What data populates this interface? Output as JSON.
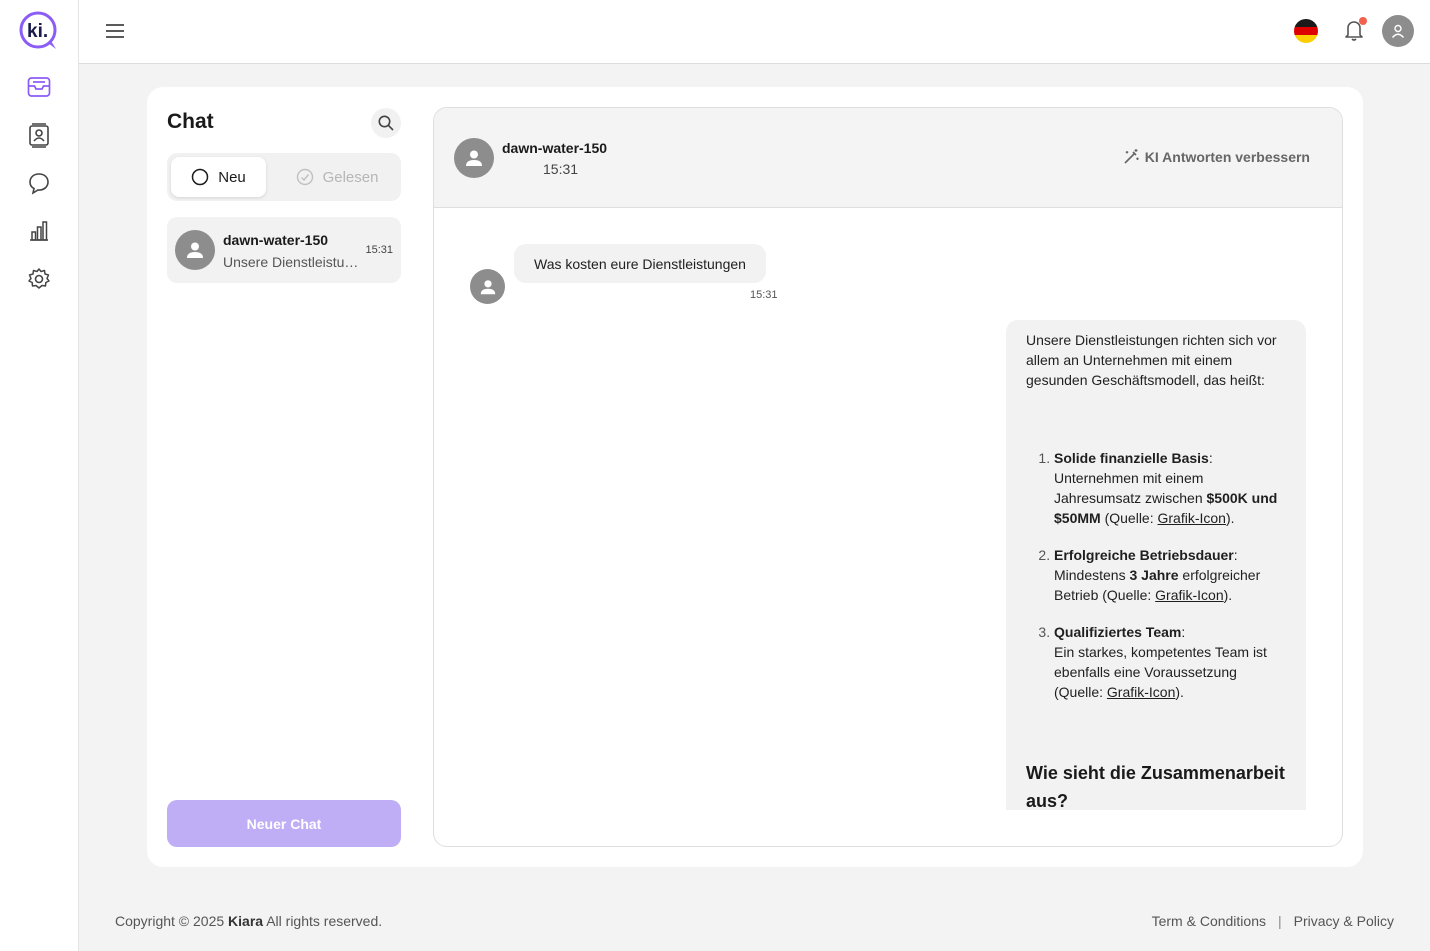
{
  "app": {
    "logo_text": "ki.",
    "brand_color": "#8b5cf6",
    "nav": [
      {
        "name": "inbox-icon",
        "active": true
      },
      {
        "name": "contacts-icon",
        "active": false
      },
      {
        "name": "chat-bubble-icon",
        "active": false
      },
      {
        "name": "bar-chart-icon",
        "active": false
      },
      {
        "name": "gear-icon",
        "active": false
      }
    ]
  },
  "topbar": {
    "language": "de",
    "notification_dot_color": "#f0624d"
  },
  "chat_list": {
    "title": "Chat",
    "tabs": [
      {
        "label": "Neu",
        "active": true
      },
      {
        "label": "Gelesen",
        "active": false
      }
    ],
    "conversations": [
      {
        "name": "dawn-water-150",
        "preview": "Unsere Dienstleistungen richten sich vor allem an Unternehmen mit einem gesunden Geschäftsmodell, das heißt:",
        "time": "15:31"
      }
    ],
    "new_chat_label": "Neuer Chat",
    "new_chat_color": "#bfadf5"
  },
  "conversation": {
    "name": "dawn-water-150",
    "time": "15:31",
    "improve_label": "KI Antworten verbessern",
    "incoming": {
      "text": "Was kosten eure Dienstleistungen",
      "time": "15:31"
    },
    "outgoing": {
      "intro": "Unsere Dienstleistungen richten sich vor allem an Unternehmen mit einem gesunden Geschäftsmodell, das heißt:",
      "items": [
        {
          "title": "Solide finanzielle Basis",
          "text_a": "Unternehmen mit einem Jahresumsatz zwischen",
          "bold": "$500K und $50MM",
          "text_b": "(Quelle:",
          "link": "Grafik-Icon",
          "end": ")."
        },
        {
          "title": "Erfolgreiche Betriebsdauer",
          "text_a": "Mindestens",
          "bold": "3 Jahre",
          "text_b": "erfolgreicher Betrieb (Quelle:",
          "link": "Grafik-Icon",
          "end": ")."
        },
        {
          "title": "Qualifiziertes Team",
          "text_a": "Ein starkes, kompetentes Team ist ebenfalls eine Voraussetzung (Quelle:",
          "link": "Grafik-Icon",
          "end": ")."
        }
      ],
      "heading": "Wie sieht die Zusammenarbeit aus?"
    }
  },
  "footer": {
    "copyright_prefix": "Copyright © 2025",
    "brand": "Kiara",
    "copyright_suffix": "All rights reserved.",
    "terms": "Term & Conditions",
    "separator": "|",
    "privacy": "Privacy & Policy"
  }
}
